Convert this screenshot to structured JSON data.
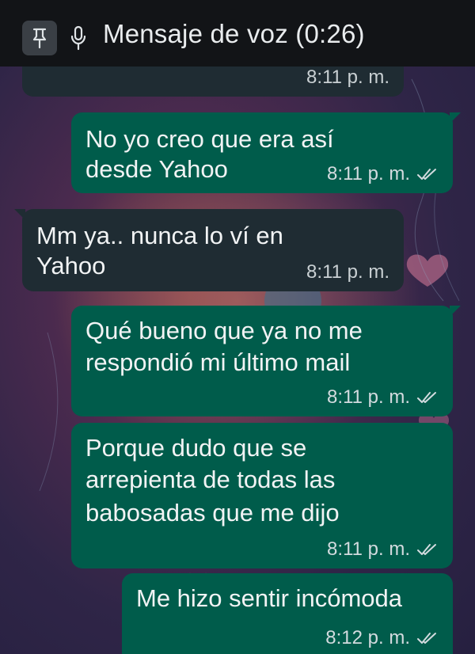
{
  "header": {
    "title": "Mensaje de voz (0:26)",
    "pin_icon": "pin-icon",
    "mic_icon": "mic-icon"
  },
  "colors": {
    "outgoing": "#005c4b",
    "incoming": "#1f2c33",
    "topbar": "#121417"
  },
  "messages": [
    {
      "direction": "incoming",
      "lines": [],
      "time": "8:11 p. m."
    },
    {
      "direction": "outgoing",
      "lines": [
        "No yo creo que era así",
        "desde Yahoo"
      ],
      "time": "8:11 p. m.",
      "status": "read-ticks-icon"
    },
    {
      "direction": "incoming",
      "lines": [
        "Mm ya.. nunca lo ví en",
        "Yahoo"
      ],
      "time": "8:11 p. m."
    },
    {
      "direction": "outgoing",
      "lines": [
        "Qué bueno que ya no me",
        "respondió mi último mail"
      ],
      "time": "8:11 p. m.",
      "status": "read-ticks-icon"
    },
    {
      "direction": "outgoing",
      "lines": [
        "Porque dudo que se",
        "arrepienta de todas las",
        "babosadas que me dijo"
      ],
      "time": "8:11 p. m.",
      "status": "read-ticks-icon"
    },
    {
      "direction": "outgoing",
      "lines": [
        "Me hizo sentir incómoda"
      ],
      "time": "8:12 p. m.",
      "status": "read-ticks-icon"
    }
  ]
}
